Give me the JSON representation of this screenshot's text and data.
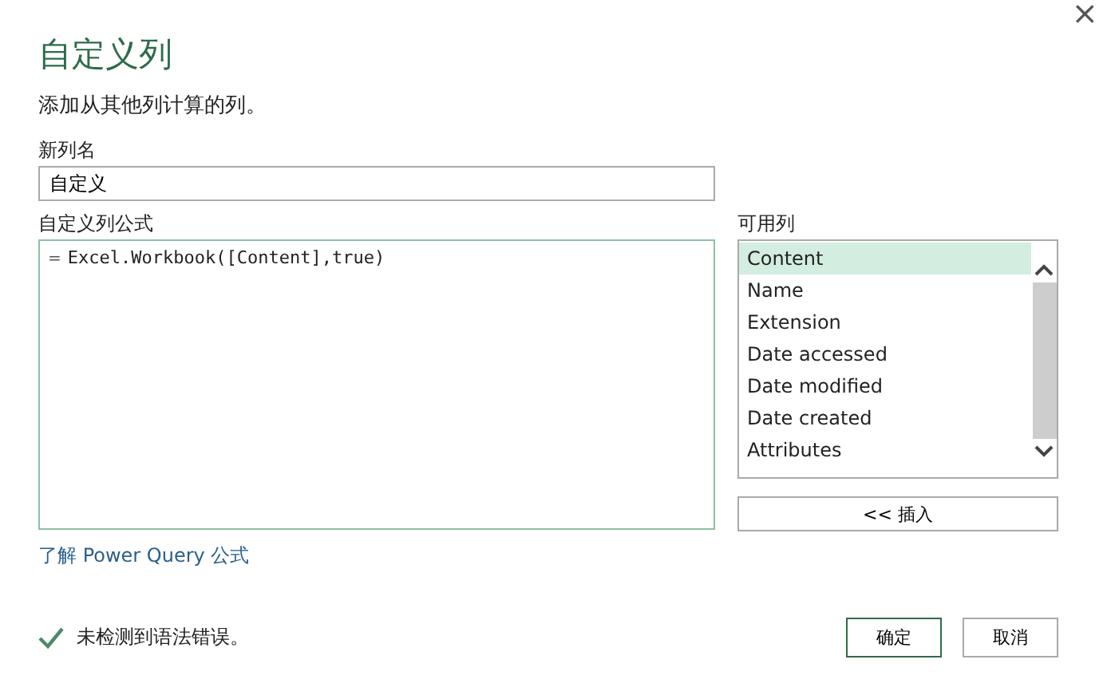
{
  "window": {
    "title": "自定义列",
    "close": "×"
  },
  "description": "添加从其他列计算的列。",
  "new_column_name": {
    "label": "新列名",
    "value": "自定义"
  },
  "formula": {
    "label": "自定义列公式",
    "prefix": "=",
    "value": "Excel.Workbook([Content],true)"
  },
  "available_columns": {
    "label": "可用列",
    "items": [
      {
        "label": "Content",
        "selected": true
      },
      {
        "label": "Name",
        "selected": false
      },
      {
        "label": "Extension",
        "selected": false
      },
      {
        "label": "Date accessed",
        "selected": false
      },
      {
        "label": "Date modified",
        "selected": false
      },
      {
        "label": "Date created",
        "selected": false
      },
      {
        "label": "Attributes",
        "selected": false
      }
    ],
    "insert_button": "<< 插入"
  },
  "help_link": "了解 Power Query 公式",
  "status": {
    "ok": true,
    "text": "未检测到语法错误。"
  },
  "buttons": [
    {
      "label": "确定",
      "default": true
    },
    {
      "label": "取消",
      "default": false
    }
  ]
}
